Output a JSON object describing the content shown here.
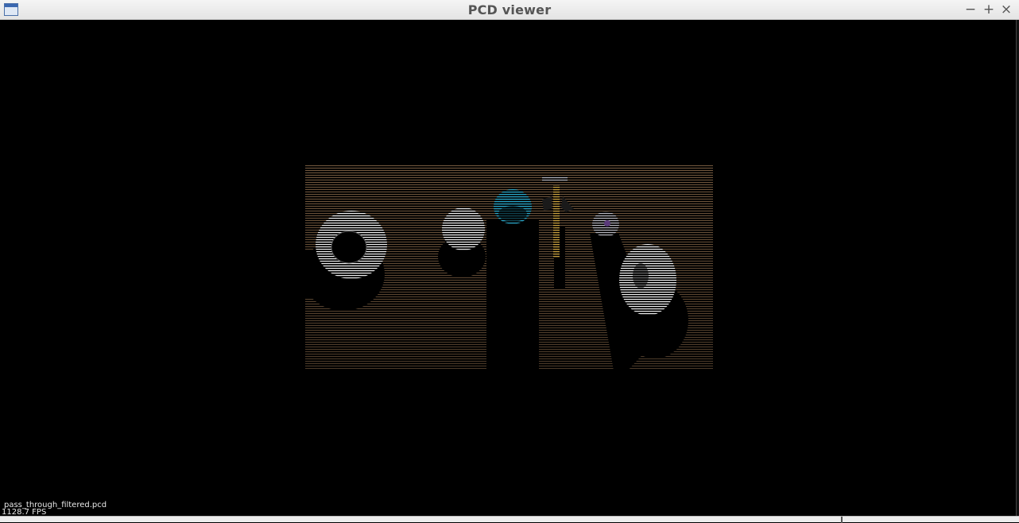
{
  "window": {
    "title": "PCD viewer",
    "minimize_glyph": "−",
    "maximize_glyph": "+",
    "close_glyph": "×",
    "icon": "window-app-icon"
  },
  "viewer": {
    "background": "#000000",
    "cloud_floor_color": "#8a6a4a",
    "cloud_object_colors": [
      "#ffffff",
      "#2aa7c9",
      "#c8a040",
      "#8c6a9a"
    ],
    "filename": "pass_through_filtered.pcd",
    "fps": "1128.7 FPS"
  }
}
